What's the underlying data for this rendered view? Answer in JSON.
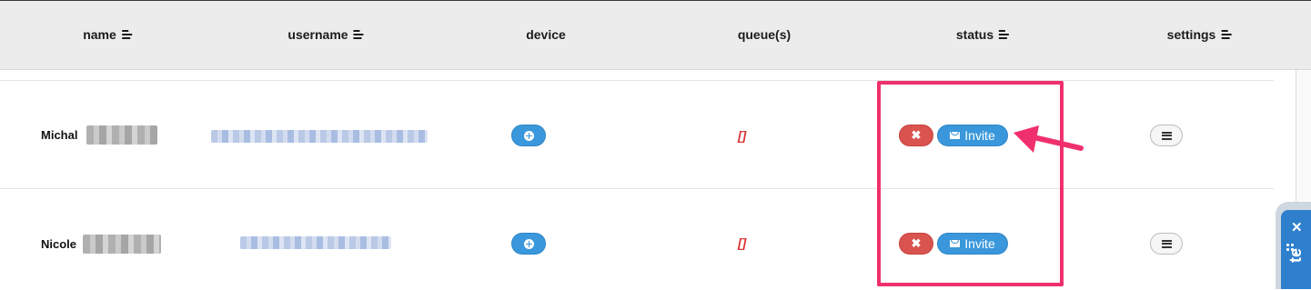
{
  "table": {
    "columns": [
      {
        "label": "name",
        "sortable": true
      },
      {
        "label": "username",
        "sortable": true
      },
      {
        "label": "device",
        "sortable": false
      },
      {
        "label": "queue(s)",
        "sortable": false
      },
      {
        "label": "status",
        "sortable": true
      },
      {
        "label": "settings",
        "sortable": true
      }
    ],
    "rows": [
      {
        "name": "Michal",
        "queue": "[]",
        "remove_label": "✖",
        "invite_label": "Invite"
      },
      {
        "name": "Nicole",
        "queue": "[]",
        "remove_label": "✖",
        "invite_label": "Invite"
      }
    ]
  },
  "side_widget": {
    "close": "✕",
    "text": "te"
  },
  "colors": {
    "header_bg": "#ececec",
    "primary": "#3a97db",
    "danger": "#d9534f",
    "highlight": "#f0306c"
  },
  "icons": [
    "sort-icon",
    "plus-circle-icon",
    "envelope-icon",
    "close-icon",
    "menu-icon",
    "arrow-annotation"
  ]
}
